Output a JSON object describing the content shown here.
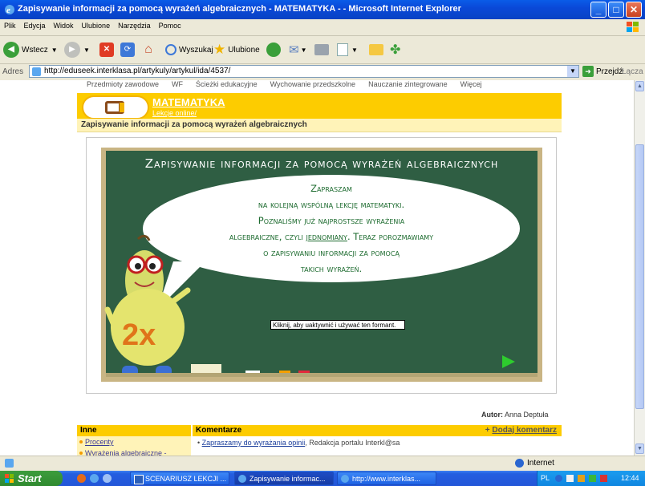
{
  "window": {
    "title": "Zapisywanie informacji za pomocą wyrażeń algebraicznych - MATEMATYKA - - Microsoft Internet Explorer"
  },
  "menu": [
    "Plik",
    "Edycja",
    "Widok",
    "Ulubione",
    "Narzędzia",
    "Pomoc"
  ],
  "toolbar": {
    "back": "Wstecz",
    "search": "Wyszukaj",
    "favorites": "Ulubione"
  },
  "address": {
    "label": "Adres",
    "url": "http://eduseek.interklasa.pl/artykuly/artykul/ida/4537/",
    "go": "Przejdź",
    "links": "Łącza"
  },
  "page": {
    "nav": [
      "Przedmioty zawodowe",
      "WF",
      "Ścieżki edukacyjne",
      "Wychowanie przedszkolne",
      "Nauczanie zintegrowane",
      "Więcej"
    ],
    "subject": "MATEMATYKA",
    "subject_sub": "Lekcje online/",
    "article_title": "Zapisywanie informacji za pomocą wyrażeń algebraicznych",
    "board_title": "Zapisywanie informacji za pomocą wyrażeń algebraicznych",
    "bubble_line1": "Zapraszam",
    "bubble_line2": "na kolejną wspólną lekcję matematyki.",
    "bubble_line3": "Poznaliśmy już najprostsze wyrażenia",
    "bubble_line4a": "algebraiczne, czyli",
    "bubble_line4b": "jednomiany",
    "bubble_line4c": ". Teraz porozmawiamy",
    "bubble_line5": "o zapisywaniu informacji za pomocą",
    "bubble_line6": "takich wyrażeń.",
    "mascot_label": "2x",
    "tooltip": "Kliknij, aby uaktywnić i używać ten formant.",
    "author_label": "Autor:",
    "author_name": "Anna Deptuła",
    "other_header": "Inne",
    "other_links": [
      "Procenty",
      "Wyrażenia algebraiczne -"
    ],
    "comments_header": "Komentarze",
    "add_comment": "Dodaj komentarz",
    "comment_link": "Zapraszamy do wyrażania opinii",
    "comment_author": ", Redakcja portalu Interkl@sa"
  },
  "status": {
    "zone": "Internet"
  },
  "taskbar": {
    "start": "Start",
    "tasks": [
      "SCENARIUSZ LEKCJI ...",
      "Zapisywanie informac...",
      "http://www.interklas..."
    ],
    "lang": "PL",
    "clock": "12:44"
  },
  "colors": {
    "accent": "#fdcc00",
    "board": "#2f5e43",
    "ie_blue": "#0a5ce8"
  }
}
